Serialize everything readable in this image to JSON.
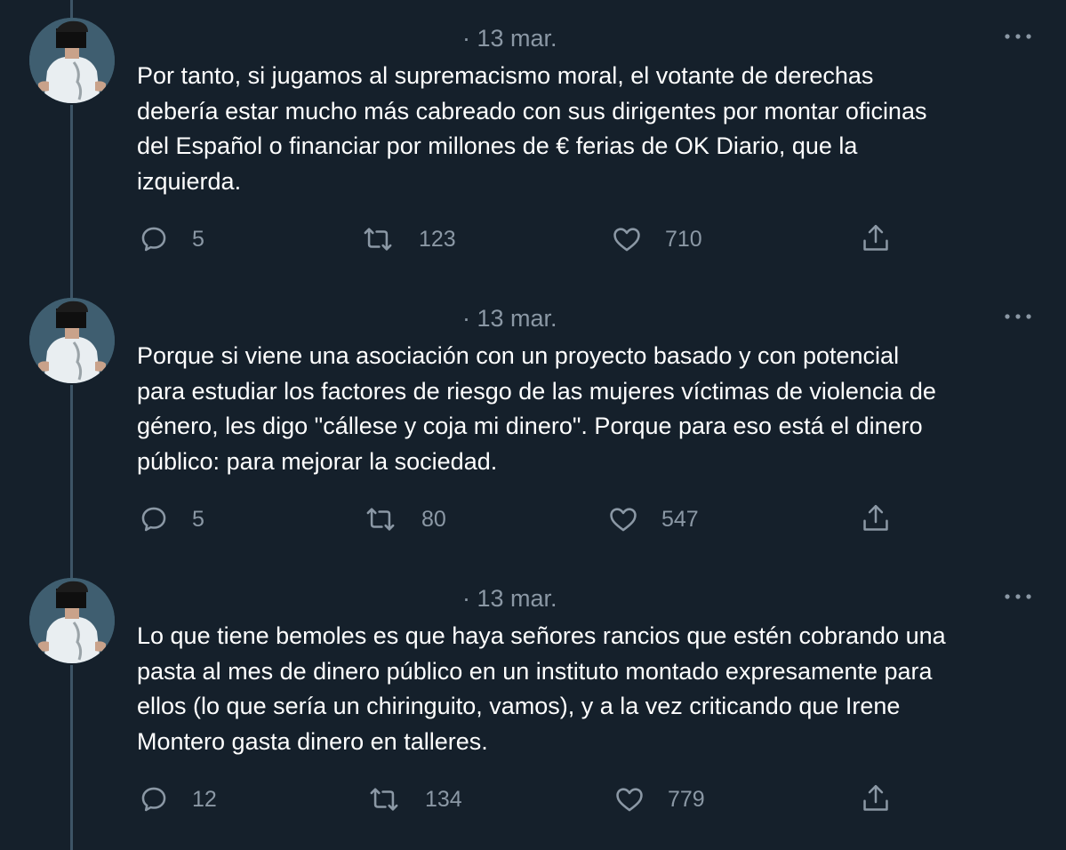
{
  "tweets": [
    {
      "timestamp": "· 13 mar.",
      "lines": [
        "Por tanto, si jugamos al supremacismo moral, el votante de derechas",
        "debería estar mucho más cabreado con sus dirigentes por montar oficinas",
        "del Español o financiar por millones de € ferias de OK Diario, que la",
        "izquierda."
      ],
      "replies": "5",
      "retweets": "123",
      "likes": "710"
    },
    {
      "timestamp": "· 13 mar.",
      "lines": [
        "Porque si viene una asociación con un proyecto basado y con potencial",
        "para estudiar los factores de riesgo de las mujeres víctimas de violencia de",
        "género, les digo \"cállese y coja mi dinero\". Porque para eso está el dinero",
        "público: para mejorar la sociedad."
      ],
      "replies": "5",
      "retweets": "80",
      "likes": "547"
    },
    {
      "timestamp": "· 13 mar.",
      "lines": [
        "Lo que tiene bemoles es que haya señores rancios que estén cobrando una",
        "pasta al mes de dinero público en un instituto montado expresamente para",
        "ellos (lo que sería un chiringuito, vamos), y a la vez criticando que Irene",
        "Montero gasta dinero en talleres."
      ],
      "replies": "12",
      "retweets": "134",
      "likes": "779"
    }
  ],
  "icons": {
    "reply": "reply-icon",
    "retweet": "retweet-icon",
    "like": "heart-icon",
    "share": "share-icon",
    "more": "more-icon",
    "avatar": "avatar"
  },
  "colors": {
    "background": "#15202b",
    "text": "#ffffff",
    "muted": "#8b98a5",
    "thread_line": "#3d5466"
  }
}
